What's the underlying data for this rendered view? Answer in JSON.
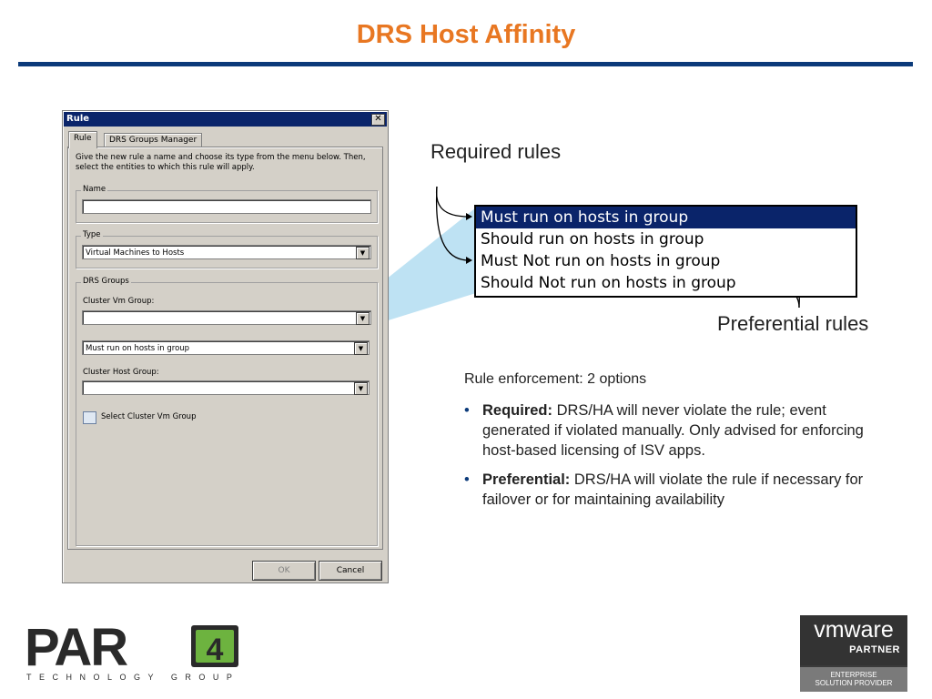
{
  "slide": {
    "title": "DRS Host Affinity"
  },
  "dialog": {
    "title": "Rule",
    "close_glyph": "✕",
    "tabs": [
      {
        "label": "Rule",
        "active": true
      },
      {
        "label": "DRS Groups Manager",
        "active": false
      }
    ],
    "description": "Give the new rule a name and choose its type from the menu below. Then, select the entities to which this rule will apply.",
    "name_group_label": "Name",
    "name_value": "",
    "type_group_label": "Type",
    "type_value": "Virtual Machines to Hosts",
    "drs_groups_label": "DRS Groups",
    "vm_group_label": "Cluster Vm Group:",
    "vm_group_value": "",
    "rule_value": "Must run on hosts in group",
    "host_group_label": "Cluster Host Group:",
    "host_group_value": "",
    "status_text": "Select Cluster Vm Group",
    "ok_label": "OK",
    "cancel_label": "Cancel",
    "dropdown_arrow": "▼"
  },
  "menu": {
    "items": [
      {
        "label": "Must run on hosts in group",
        "selected": true
      },
      {
        "label": "Should run on hosts in group",
        "selected": false
      },
      {
        "label": "Must Not run on hosts in group",
        "selected": false
      },
      {
        "label": "Should Not run on hosts in group",
        "selected": false
      }
    ]
  },
  "annotations": {
    "required_rules": "Required rules",
    "preferential_rules": "Preferential rules"
  },
  "enforcement": {
    "heading": "Rule enforcement: 2 options",
    "bullets": [
      {
        "bold": "Required:",
        "text": " DRS/HA will never violate the rule; event generated if violated manually. Only advised for enforcing host-based licensing of ISV apps."
      },
      {
        "bold": "Preferential:",
        "text": " DRS/HA will violate the rule if necessary for failover or for maintaining availability"
      }
    ]
  },
  "logos": {
    "par4_text": "PAR",
    "par4_digit": "4",
    "par4_sub": "TECHNOLOGY GROUP",
    "vmware_name": "vmware",
    "vmware_partner": "PARTNER",
    "vmware_tier_1": "ENTERPRISE",
    "vmware_tier_2": "SOLUTION PROVIDER"
  },
  "colors": {
    "title": "#e87722",
    "rule_line": "#0b3a7a",
    "menu_selected": "#0a246a",
    "callout": "#a8d8ef"
  }
}
